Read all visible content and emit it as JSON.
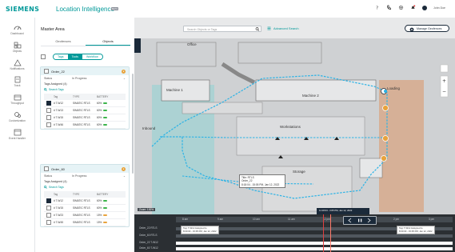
{
  "header": {
    "brand": "SIEMENS",
    "app_title": "Location Intelligence",
    "beta": "BETA",
    "user_name": "John Doe"
  },
  "nav": [
    {
      "label": "Dashboard",
      "icon": "dashboard-icon"
    },
    {
      "label": "Objects",
      "icon": "objects-icon"
    },
    {
      "label": "Notifications",
      "icon": "notifications-icon"
    },
    {
      "label": "Track",
      "icon": "track-icon"
    },
    {
      "label": "Throughput",
      "icon": "throughput-icon"
    },
    {
      "label": "Customization",
      "icon": "customization-icon"
    },
    {
      "label": "Event Handler",
      "icon": "event-handler-icon"
    }
  ],
  "panel": {
    "title": "Master Area",
    "tabs": [
      "Geofences",
      "Objects"
    ],
    "active_tab": "Objects",
    "filters": [
      "Tags",
      "Tools",
      "Workflow"
    ],
    "active_filter": "Tools",
    "orders": [
      {
        "name": "Order_22",
        "status_label": "Status",
        "status_value": "In Progress",
        "tags_assigned": "Tags Assigned (4)",
        "search_placeholder": "Search Tags",
        "columns": [
          "Tag",
          "TYPE",
          "BATTERY"
        ],
        "rows": [
          {
            "tag": "# T-W12",
            "type": "SIMATIC RTLS",
            "battery": "60%",
            "checked": true,
            "color": "#3cb44b"
          },
          {
            "tag": "# T-W13",
            "type": "SIMATIC RTLS",
            "battery": "60%",
            "checked": false,
            "color": "#3cb44b"
          },
          {
            "tag": "# T-W15",
            "type": "SIMATIC RTLS",
            "battery": "60%",
            "checked": false,
            "color": "#3cb44b"
          },
          {
            "tag": "# T-W46",
            "type": "SIMATIC RTLS",
            "battery": "60%",
            "checked": false,
            "color": "#3cb44b"
          }
        ]
      },
      {
        "name": "Order_60",
        "status_label": "Status",
        "status_value": "In Progress",
        "tags_assigned": "Tags Assigned (4)",
        "search_placeholder": "Search Tags",
        "columns": [
          "Tag",
          "TYPE",
          "BATTERY"
        ],
        "rows": [
          {
            "tag": "# T-W12",
            "type": "SIMATIC RTLS",
            "battery": "60%",
            "checked": true,
            "color": "#3cb44b"
          },
          {
            "tag": "# T-W15",
            "type": "SIMATIC RTLS",
            "battery": "60%",
            "checked": false,
            "color": "#3cb44b"
          },
          {
            "tag": "# T-W23",
            "type": "SIMATIC RTLS",
            "battery": "15%",
            "checked": false,
            "color": "#e8a33c"
          },
          {
            "tag": "# T-W45",
            "type": "SIMATIC RTLS",
            "battery": "15%",
            "checked": false,
            "color": "#e8a33c"
          }
        ]
      }
    ]
  },
  "map": {
    "search_placeholder": "Search Objects or Tags",
    "advanced_search": "Advanced Search",
    "manage_geofences": "Manage Geofences",
    "zones": [
      "Office",
      "Machine 1",
      "Machine 2",
      "Loading",
      "Inbound",
      "Workstations",
      "Storage"
    ],
    "detail_tip": [
      "Title: RTLS",
      "Order_22",
      "8:18:04 - 15:05 PM, Jan 12, 2022"
    ],
    "zoom_label": "Zoom: 100%"
  },
  "timeline": {
    "ticks": [
      "8 am",
      "9 am",
      "10 am",
      "11 am",
      "12 pm",
      "1 pm",
      "2 pm",
      "3 pm"
    ],
    "current_time": "11:18:04 - 3:05 PM, Jan 12, 2022",
    "rows": [
      "Order_22 RTLS",
      "Order_60 RTLS",
      "Order_22 T-W12",
      "Order_60 T-W12"
    ],
    "tooltip_left": [
      "Tag: T-W12 Assigned to",
      "8:00:00 - 15:05 PM, Jan 12, 2022"
    ],
    "tooltip_right": [
      "Tag: T-W12 Assigned to",
      "8:00:00 - 15:05 PM, Jan 12, 2022"
    ]
  },
  "colors": {
    "accent": "#009999",
    "dark": "#1b2a3a",
    "path": "#2bb3e6",
    "loading_zone": "#d9a27d",
    "inbound_zone": "#8fd3d3"
  }
}
